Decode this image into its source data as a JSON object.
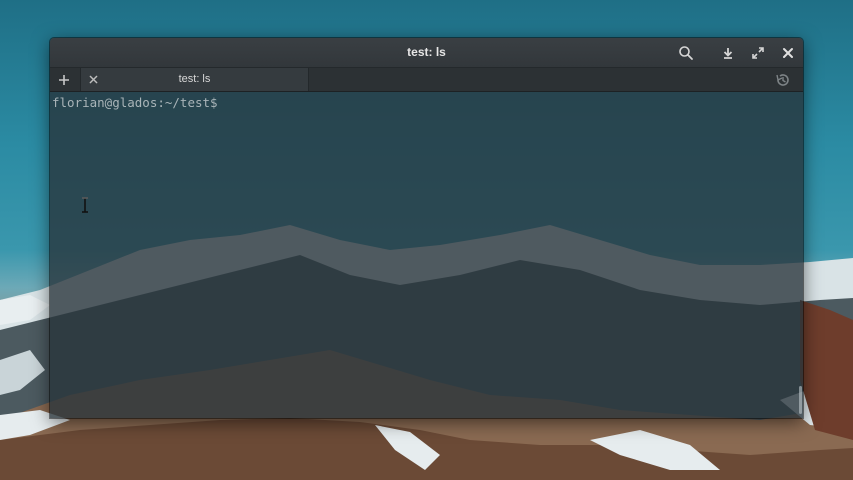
{
  "window": {
    "title": "test: ls"
  },
  "titlebar_buttons": {
    "search": "search-icon",
    "download": "download-icon",
    "maximize": "maximize-icon",
    "close": "close-icon"
  },
  "tabbar": {
    "new_tab": "+",
    "tabs": [
      {
        "label": "test: ls",
        "active": true
      }
    ],
    "history": "history-icon"
  },
  "terminal": {
    "prompt": "florian@glados:~/test$"
  },
  "colors": {
    "prompt_text": "#a9b4b8",
    "titlebar": "#363b3f",
    "terminal_bg": "#28333a"
  }
}
